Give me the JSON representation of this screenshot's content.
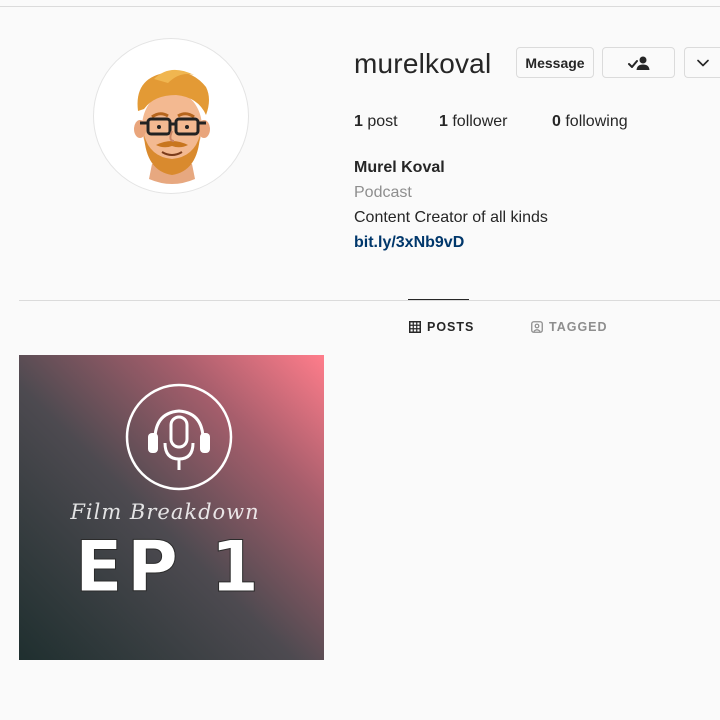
{
  "profile": {
    "username": "murelkoval",
    "full_name": "Murel Koval",
    "category": "Podcast",
    "bio": "Content Creator of all kinds",
    "link": "bit.ly/3xNb9vD",
    "avatar_icon": "cartoon-avatar"
  },
  "actions": {
    "message_label": "Message",
    "following_icon": "person-check-icon",
    "more_icon": "chevron-down-icon"
  },
  "stats": {
    "posts_count": "1",
    "posts_label": " post",
    "followers_count": "1",
    "followers_label": " follower",
    "following_count": "0",
    "following_label": " following"
  },
  "tabs": [
    {
      "label": "POSTS",
      "icon": "grid-icon",
      "active": true
    },
    {
      "label": "TAGGED",
      "icon": "tagged-icon",
      "active": false
    }
  ],
  "posts": [
    {
      "title": "Film Breakdown",
      "episode": "EP 1",
      "icon": "podcast-microphone-icon",
      "gradient": [
        "#243131",
        "#f47a88"
      ]
    }
  ],
  "colors": {
    "background": "#fafafa",
    "text": "#262626",
    "secondary": "#8e8e8e",
    "link": "#00376b",
    "border": "#dbdbdb"
  }
}
